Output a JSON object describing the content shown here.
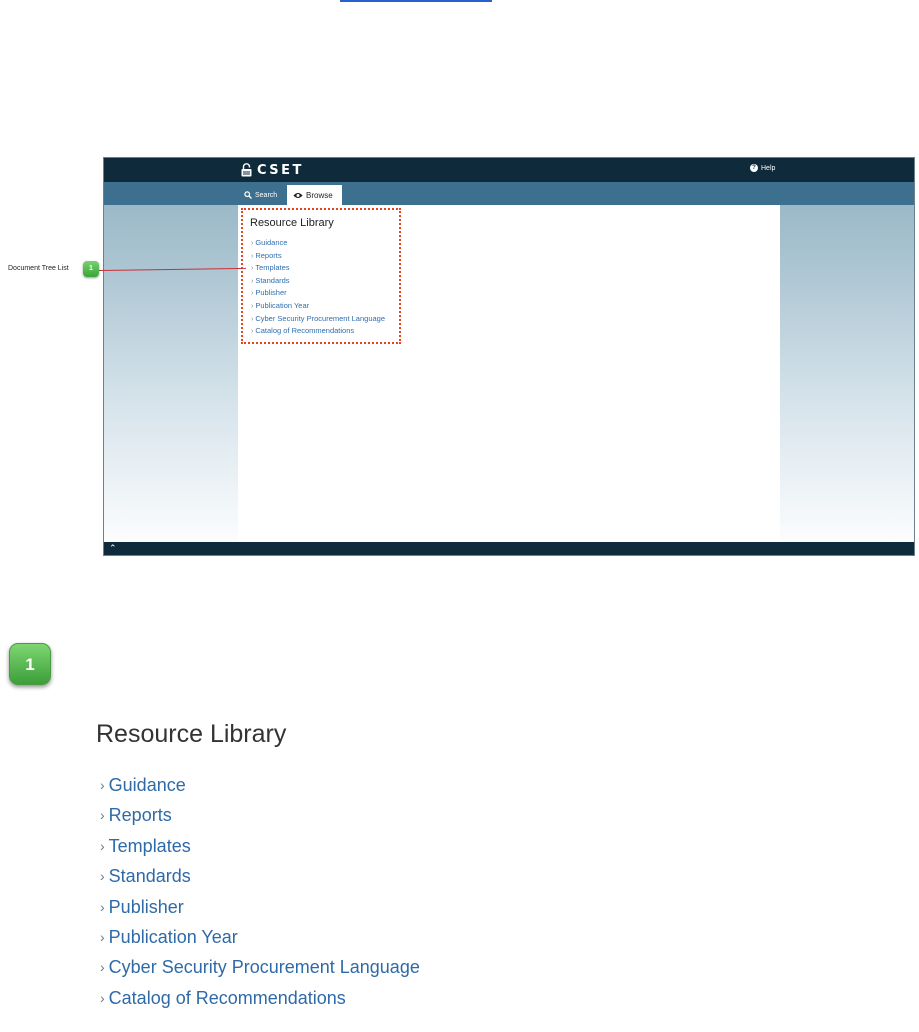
{
  "app": {
    "logo_text": "CSET",
    "help_label": "Help"
  },
  "tabs": [
    {
      "label": "Search",
      "icon": "search-icon",
      "selected": false
    },
    {
      "label": "Browse",
      "icon": "eye-icon",
      "selected": true
    }
  ],
  "library": {
    "title": "Resource Library",
    "items": [
      "Guidance",
      "Reports",
      "Templates",
      "Standards",
      "Publisher",
      "Publication Year",
      "Cyber Security Procurement Language",
      "Catalog of Recommendations"
    ]
  },
  "callout": {
    "label": "Document Tree List",
    "badge": "1"
  },
  "detail": {
    "badge": "1",
    "title": "Resource Library"
  },
  "colors": {
    "header": "#0f2a3b",
    "tab_bar": "#3d6f8e",
    "link": "#2f6eb0",
    "highlight": "#e8431a",
    "badge": "#4caf50"
  }
}
